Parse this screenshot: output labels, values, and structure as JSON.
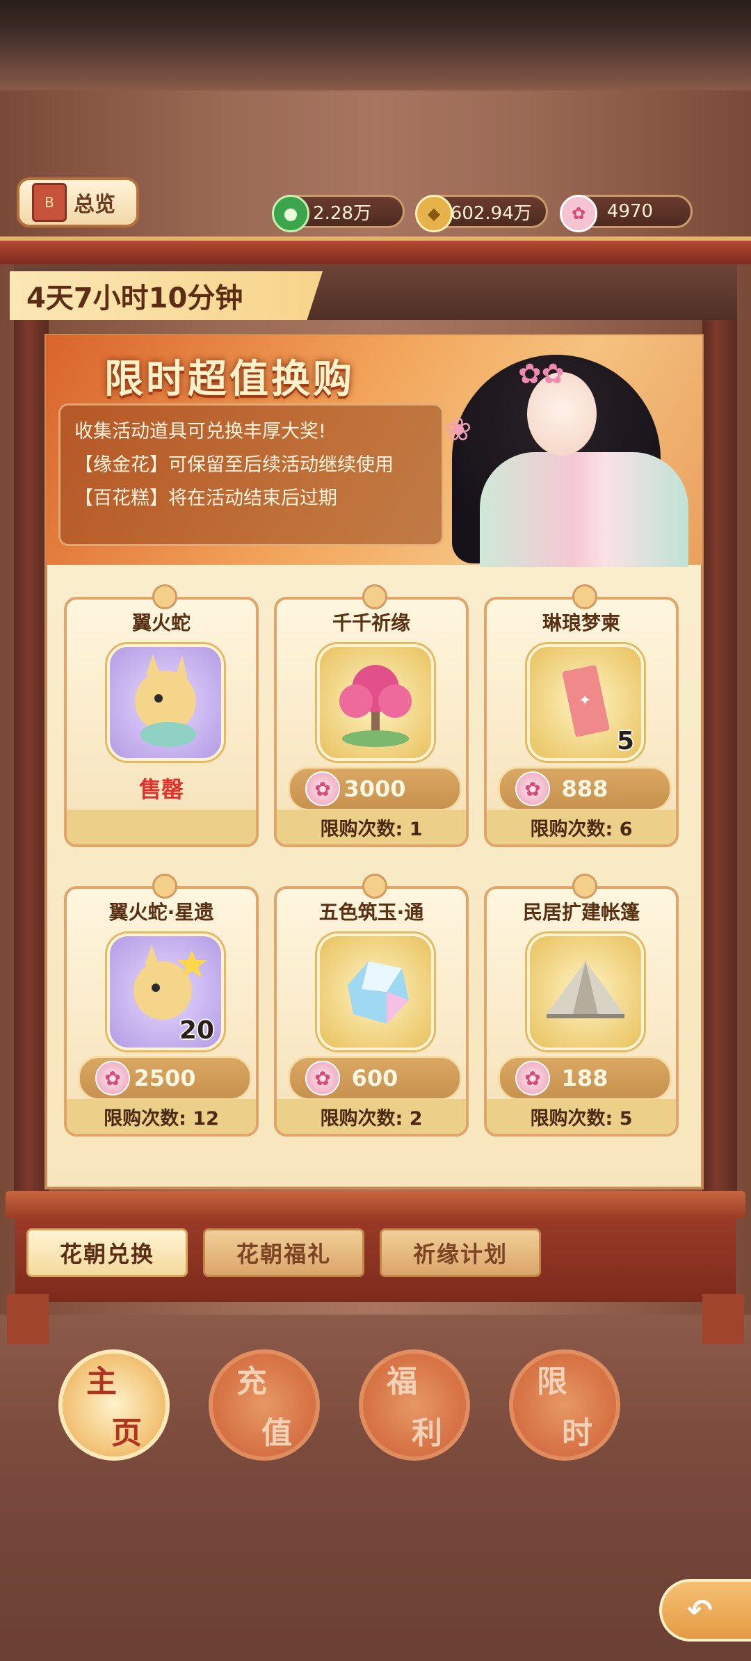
{
  "header": {
    "overview_label": "总览",
    "overview_icon_text": "B",
    "resources": [
      {
        "icon": "jade-coin-icon",
        "value": "2.28万"
      },
      {
        "icon": "gold-coin-icon",
        "value": "3602.94万"
      },
      {
        "icon": "flower-icon",
        "value": "4970"
      }
    ]
  },
  "timer": {
    "text": "4天7小时10分钟"
  },
  "banner": {
    "title": "限时超值换购",
    "lines": [
      "收集活动道具可兑换丰厚大奖!",
      "【缘金花】可保留至后续活动继续使用",
      "【百花糕】将在活动结束后过期"
    ]
  },
  "items": [
    {
      "name": "翼火蛇",
      "icon": "fire-snake-icon",
      "qty": "",
      "price": "",
      "status": "售罄",
      "limit": ""
    },
    {
      "name": "千千祈缘",
      "icon": "blossom-tree-icon",
      "qty": "",
      "price": "3000",
      "status": "",
      "limit": "限购次数: 1"
    },
    {
      "name": "琳琅梦柬",
      "icon": "invitation-card-icon",
      "qty": "5",
      "price": "888",
      "status": "",
      "limit": "限购次数: 6"
    },
    {
      "name": "翼火蛇·星遗",
      "icon": "fire-snake-star-icon",
      "qty": "20",
      "price": "2500",
      "status": "",
      "limit": "限购次数: 12"
    },
    {
      "name": "五色筑玉·通",
      "icon": "crystal-gem-icon",
      "qty": "",
      "price": "600",
      "status": "",
      "limit": "限购次数: 2"
    },
    {
      "name": "民居扩建帐篷",
      "icon": "tent-icon",
      "qty": "",
      "price": "188",
      "status": "",
      "limit": "限购次数: 5"
    }
  ],
  "subtabs": [
    "花朝兑换",
    "花朝福礼",
    "祈缘计划"
  ],
  "nav": [
    {
      "c1": "主",
      "c2": "页"
    },
    {
      "c1": "充",
      "c2": "值"
    },
    {
      "c1": "福",
      "c2": "利"
    },
    {
      "c1": "限",
      "c2": "时"
    }
  ],
  "colors": {
    "accent": "#c98a55",
    "sold_out": "#e0322b",
    "panel": "#fbf0d2"
  }
}
